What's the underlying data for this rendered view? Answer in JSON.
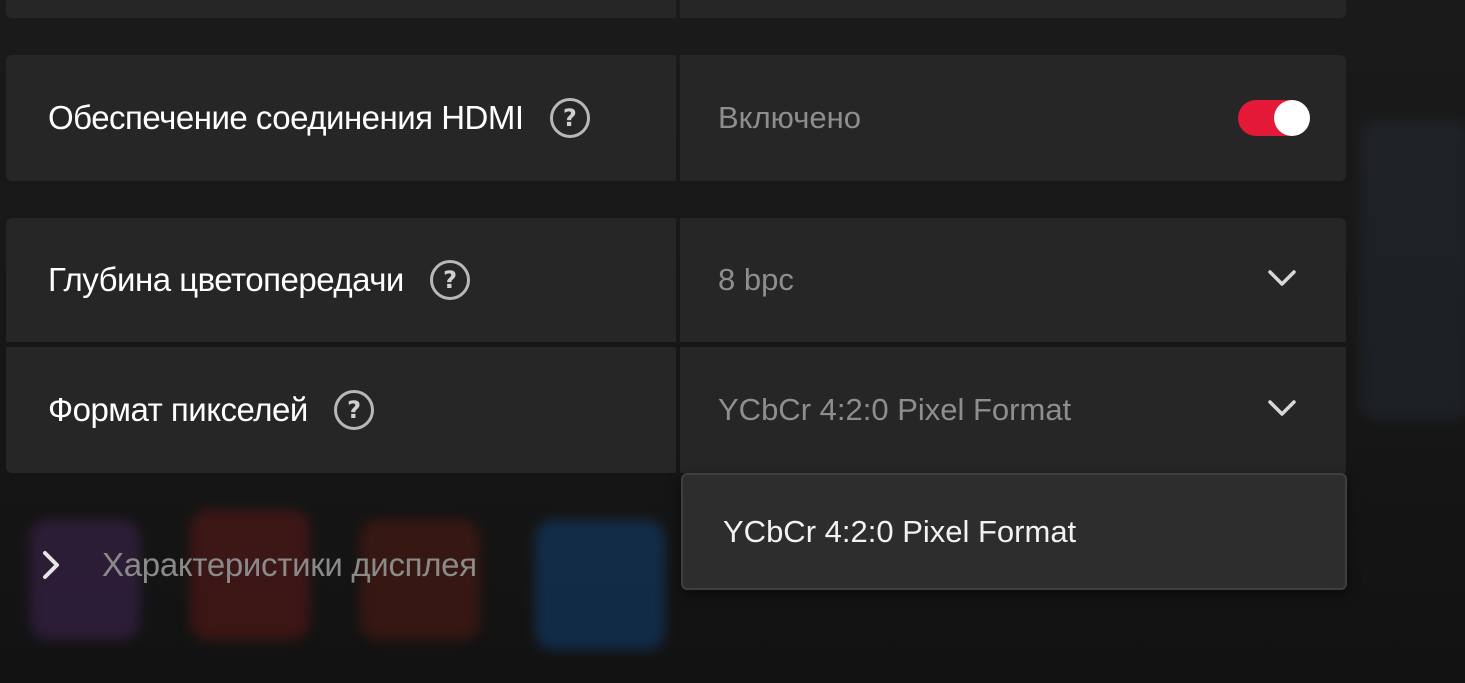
{
  "settings": {
    "hdmi": {
      "label": "Обеспечение соединения HDMI",
      "value": "Включено",
      "enabled": true
    },
    "color_depth": {
      "label": "Глубина цветопередачи",
      "value": "8 bpc"
    },
    "pixel_format": {
      "label": "Формат пикселей",
      "value": "YCbCr 4:2:0 Pixel Format",
      "options": [
        "YCbCr 4:2:0 Pixel Format"
      ]
    }
  },
  "section": {
    "label": "Характеристики дисплея"
  },
  "colors": {
    "accent": "#e31937",
    "row_bg": "#262626",
    "text_primary": "#ffffff",
    "text_secondary": "#8e8e8e"
  },
  "icons": {
    "help": "question-circle-icon",
    "dropdown": "chevron-down-icon",
    "expand": "chevron-right-icon"
  }
}
